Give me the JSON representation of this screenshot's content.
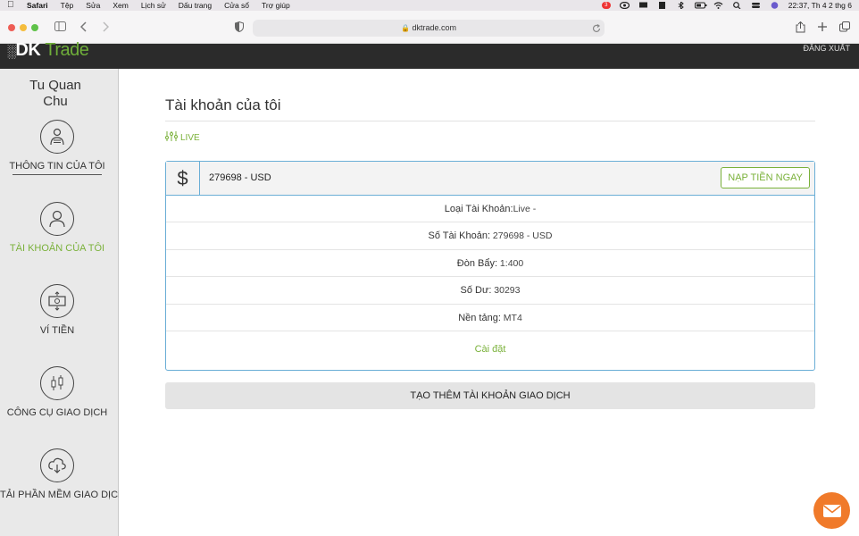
{
  "menubar": {
    "app": "Safari",
    "items": [
      "Tệp",
      "Sửa",
      "Xem",
      "Lịch sử",
      "Dấu trang",
      "Cửa sổ",
      "Trợ giúp"
    ],
    "badge": "3",
    "clock": "22:37, Th 4 2 thg 6"
  },
  "browser": {
    "url": "dktrade.com"
  },
  "site": {
    "logo_prefix": "DK",
    "logo_suffix": "Trade",
    "logout": "ĐĂNG XUẤT"
  },
  "sidebar": {
    "user_name": "Tu Quan Chu",
    "items": [
      {
        "label": "THÔNG TIN CỦA TÔI",
        "icon": "profile-icon"
      },
      {
        "label": "TÀI KHOẢN CỦA TÔI",
        "icon": "user-icon"
      },
      {
        "label": "VÍ TIỀN",
        "icon": "wallet-icon"
      },
      {
        "label": "CÔNG CỤ GIAO DỊCH",
        "icon": "candlestick-icon"
      },
      {
        "label": "TẢI PHẦN MỀM GIAO DỊCH",
        "icon": "cloud-download-icon"
      }
    ],
    "colors": {
      "active": "#7ab13a"
    }
  },
  "main": {
    "title": "Tài khoản của tôi",
    "live_label": "LIVE",
    "card": {
      "account": "279698 - USD",
      "deposit_button": "NẠP TIỀN NGAY",
      "rows": [
        {
          "label": "Loại Tài Khoản:",
          "value": "Live -"
        },
        {
          "label": "Số Tài Khoản:",
          "value": " 279698 - USD"
        },
        {
          "label": "Đòn Bẩy:",
          "value": " 1:400"
        },
        {
          "label": "Số Dư:",
          "value": " 30293"
        },
        {
          "label": "Nền tảng:",
          "value": " MT4"
        }
      ],
      "settings": "Cài đặt"
    },
    "create_button": "TẠO THÊM TÀI KHOẢN GIAO DỊCH"
  }
}
